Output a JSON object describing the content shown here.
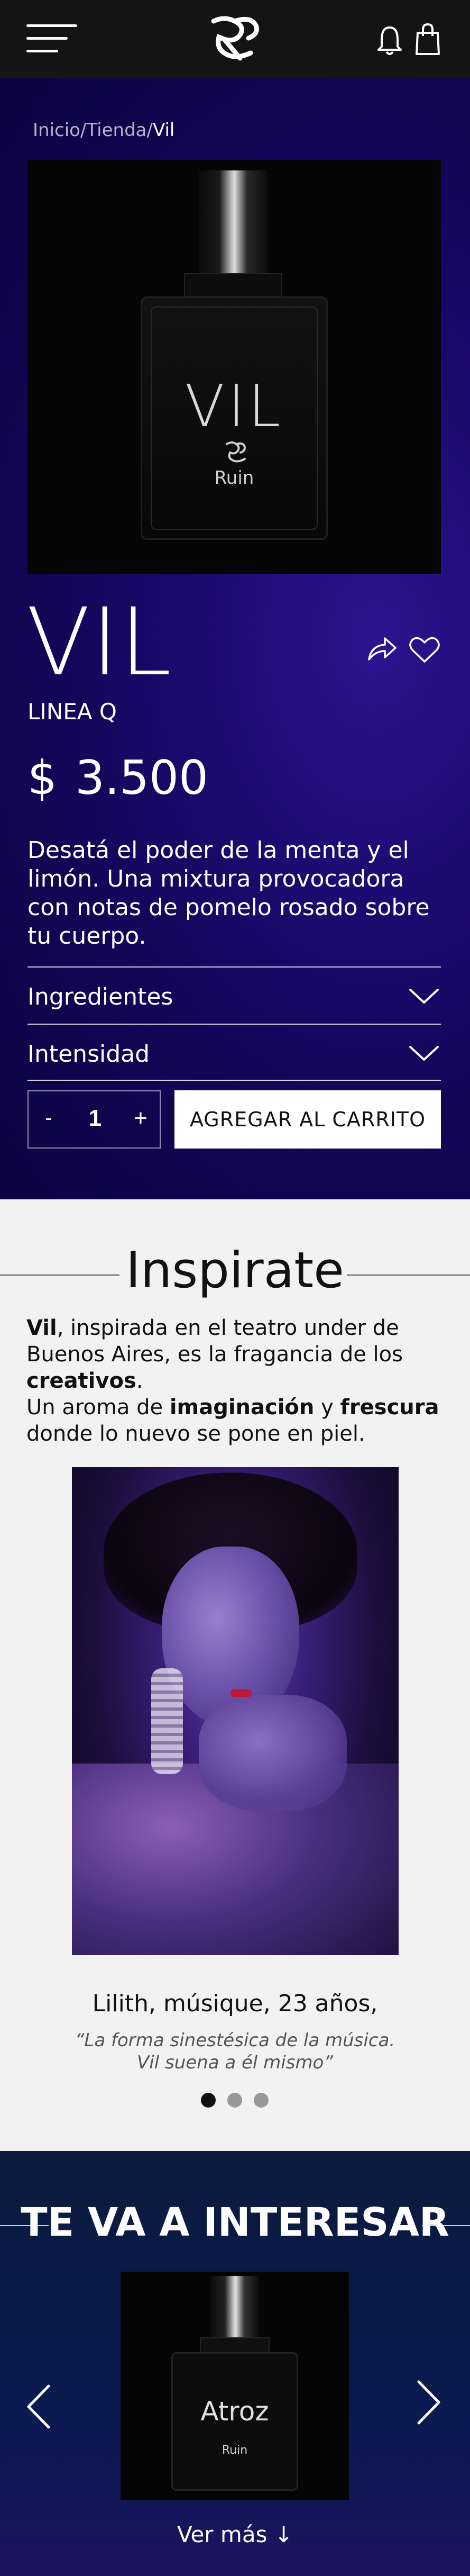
{
  "header": {
    "menu_icon": "hamburger-icon",
    "logo_icon": "ruin-logo",
    "notifications_icon": "bell-icon",
    "cart_icon": "shopping-bag-icon"
  },
  "breadcrumb": {
    "items": [
      "Inicio",
      "Tienda",
      "Vil"
    ],
    "separator": "/"
  },
  "product": {
    "image_label": "VIL",
    "image_brand": "Ruin",
    "name": "VIL",
    "line": "LINEA Q",
    "currency": "$",
    "price": "3.500",
    "description": "Desatá el poder de la menta y el limón. Una mixtura provocadora con notas de pomelo rosado sobre tu cuerpo.",
    "accordions": [
      {
        "label": "Ingredientes"
      },
      {
        "label": "Intensidad"
      }
    ],
    "quantity": {
      "minus": "-",
      "value": "1",
      "plus": "+"
    },
    "add_to_cart": "AGREGAR AL CARRITO"
  },
  "inspire": {
    "title": "Inspirate",
    "text": {
      "p1_bold": "Vil",
      "p1_rest": ", inspirada en el teatro under de Buenos Aires, es la fragancia de los ",
      "p1_bold2": "creativos",
      "p1_end": ".",
      "p2_start": "Un aroma de ",
      "p2_bold1": "imaginación",
      "p2_mid": " y ",
      "p2_bold2": "frescura",
      "p2_end": " donde lo nuevo se pone en piel."
    },
    "person": "Lilith,  músique, 23 años,",
    "quote_line1": "“La forma sinestésica de la música.",
    "quote_line2": "Vil suena a él mismo”",
    "dots": {
      "count": 3,
      "active": 0
    },
    "colors": {
      "dot_active": "#111111",
      "dot_inactive": "#999999"
    }
  },
  "interest": {
    "title": "TE VA A INTERESAR",
    "card_label": "Atroz",
    "card_brand": "Ruin",
    "see_more": "Ver más",
    "see_more_icon": "arrow-down-icon"
  },
  "colors": {
    "header_bg": "#141414",
    "hero_bg": "#1b0a6e",
    "inspire_bg": "#f2f2f2",
    "interest_bg": "#0a1a50"
  }
}
